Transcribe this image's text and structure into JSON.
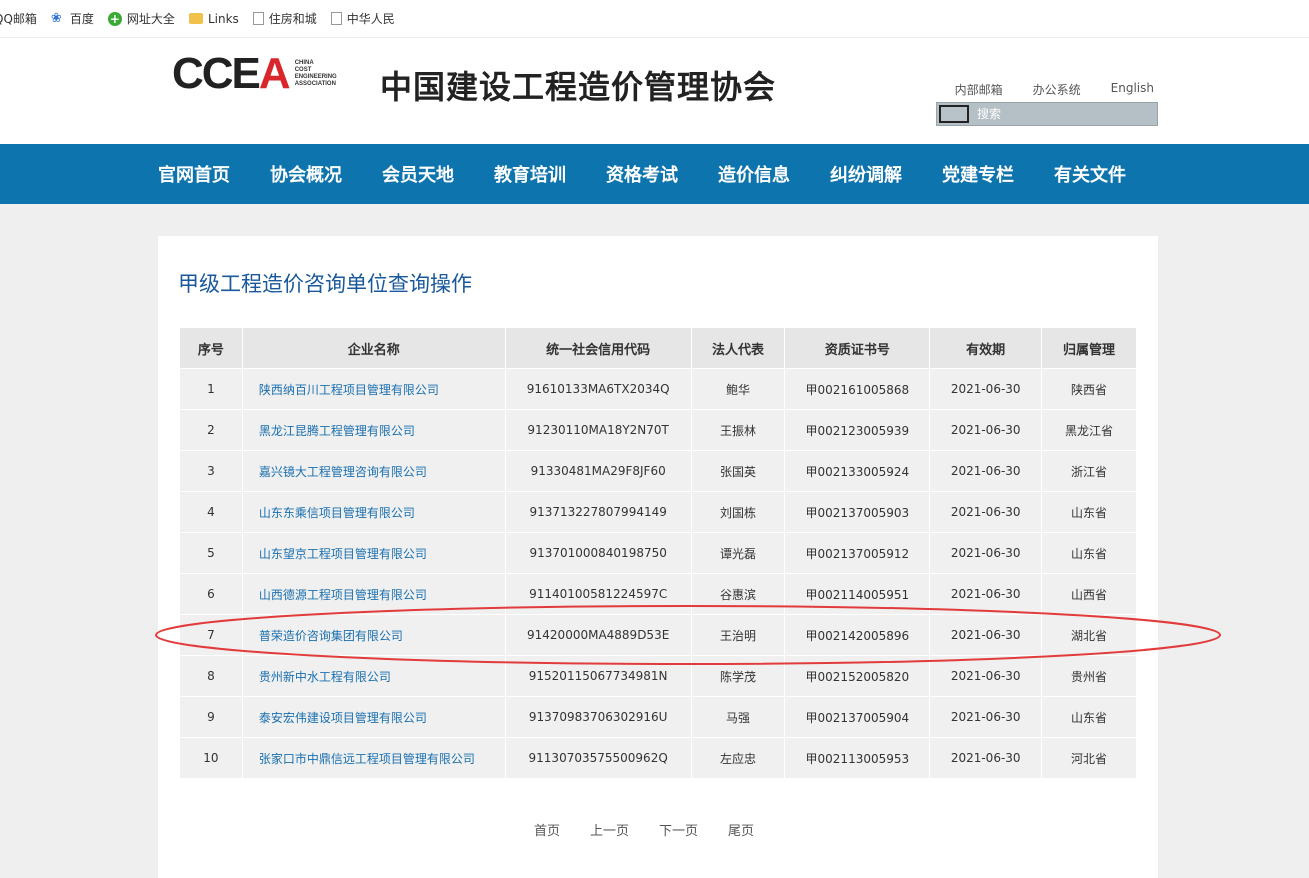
{
  "bookmarks": [
    "QQ邮箱",
    "百度",
    "网址大全",
    "Links",
    "住房和城",
    "中华人民"
  ],
  "header": {
    "logo_text": "CCEA",
    "logo_en": [
      "CHINA",
      "COST",
      "ENGINEERING",
      "ASSOCIATION"
    ],
    "site_title": "中国建设工程造价管理协会",
    "links": [
      "内部邮箱",
      "办公系统",
      "English"
    ],
    "search_placeholder": "搜索"
  },
  "nav": [
    "官网首页",
    "协会概况",
    "会员天地",
    "教育培训",
    "资格考试",
    "造价信息",
    "纠纷调解",
    "党建专栏",
    "有关文件"
  ],
  "page_heading": "甲级工程造价咨询单位查询操作",
  "table": {
    "headers": [
      "序号",
      "企业名称",
      "统一社会信用代码",
      "法人代表",
      "资质证书号",
      "有效期",
      "归属管理"
    ],
    "rows": [
      [
        "1",
        "陕西纳百川工程项目管理有限公司",
        "91610133MA6TX2034Q",
        "鲍华",
        "甲002161005868",
        "2021-06-30",
        "陕西省"
      ],
      [
        "2",
        "黑龙江昆腾工程管理有限公司",
        "91230110MA18Y2N70T",
        "王振林",
        "甲002123005939",
        "2021-06-30",
        "黑龙江省"
      ],
      [
        "3",
        "嘉兴镜大工程管理咨询有限公司",
        "91330481MA29F8JF60",
        "张国英",
        "甲002133005924",
        "2021-06-30",
        "浙江省"
      ],
      [
        "4",
        "山东东乘信项目管理有限公司",
        "913713227807994149",
        "刘国栋",
        "甲002137005903",
        "2021-06-30",
        "山东省"
      ],
      [
        "5",
        "山东望京工程项目管理有限公司",
        "913701000840198750",
        "谭光磊",
        "甲002137005912",
        "2021-06-30",
        "山东省"
      ],
      [
        "6",
        "山西德源工程项目管理有限公司",
        "91140100581224597C",
        "谷惠滨",
        "甲002114005951",
        "2021-06-30",
        "山西省"
      ],
      [
        "7",
        "普荣造价咨询集团有限公司",
        "91420000MA4889D53E",
        "王治明",
        "甲002142005896",
        "2021-06-30",
        "湖北省"
      ],
      [
        "8",
        "贵州新中水工程有限公司",
        "91520115067734981N",
        "陈学茂",
        "甲002152005820",
        "2021-06-30",
        "贵州省"
      ],
      [
        "9",
        "泰安宏伟建设项目管理有限公司",
        "91370983706302916U",
        "马强",
        "甲002137005904",
        "2021-06-30",
        "山东省"
      ],
      [
        "10",
        "张家口市中鼎信远工程项目管理有限公司",
        "91130703575500962Q",
        "左应忠",
        "甲002113005953",
        "2021-06-30",
        "河北省"
      ]
    ]
  },
  "pager": [
    "首页",
    "上一页",
    "下一页",
    "尾页"
  ],
  "colors": {
    "nav_bg": "#0e74ad",
    "link": "#1a6fb0",
    "highlight": "#e23b3b"
  }
}
